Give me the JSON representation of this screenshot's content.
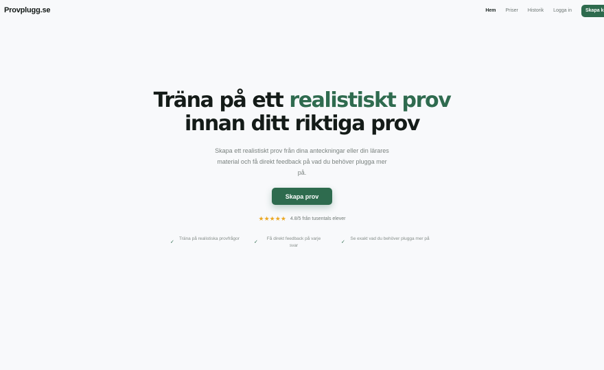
{
  "header": {
    "logo": "Provplugg.se",
    "nav": [
      "Hem",
      "Priser",
      "Historik",
      "Logga in"
    ],
    "cta": "Skapa k"
  },
  "hero": {
    "title_line1_plain": "Träna på ett ",
    "title_line1_accent": "realistiskt prov",
    "title_line2": "innan ditt riktiga prov",
    "subtitle": "Skapa ett realistiskt prov från dina anteckningar eller din lärares material och få direkt feedback på vad du behöver plugga mer på.",
    "button": "Skapa prov"
  },
  "rating": {
    "stars": 5,
    "text": "4.8/5 från tusentals elever"
  },
  "features": [
    "Träna på realistiska provfrågor",
    "Få direkt feedback på varje svar",
    "Se exakt vad du behöver plugga mer på"
  ],
  "colors": {
    "accent": "#2e6b4e",
    "star": "#eba722",
    "background": "#f8f9fb"
  }
}
